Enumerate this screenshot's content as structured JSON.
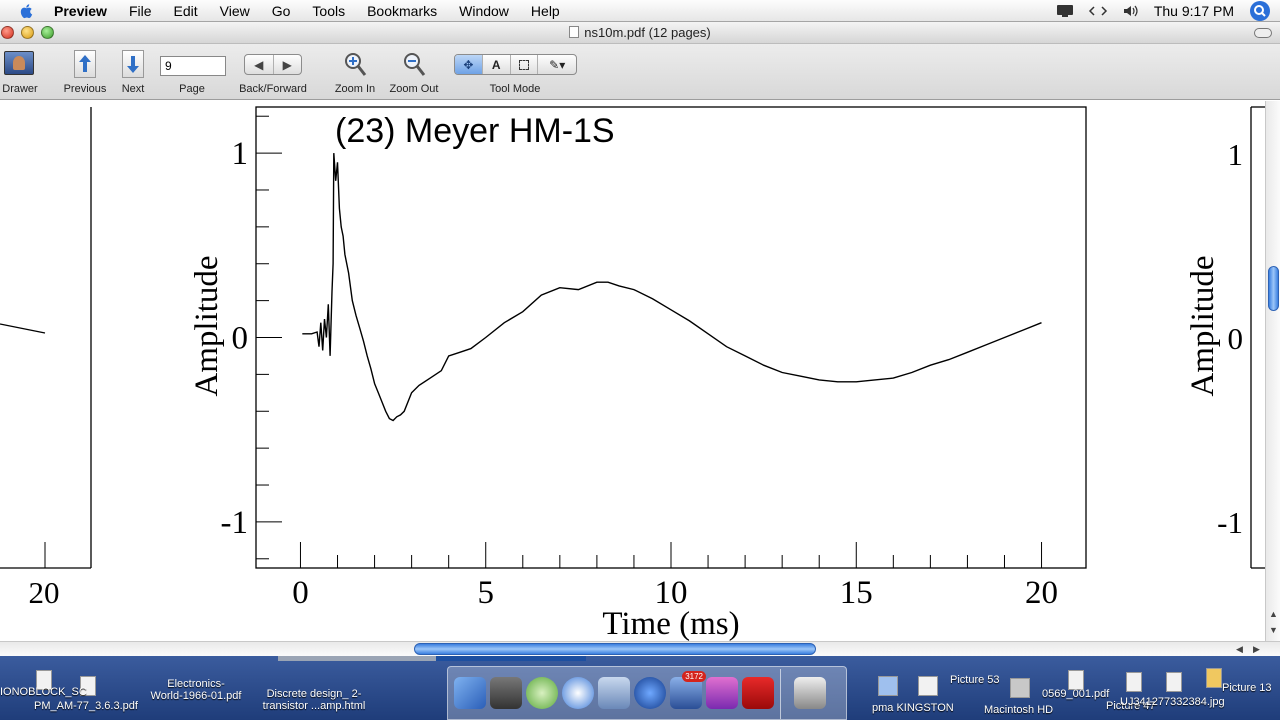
{
  "menubar": {
    "app_name": "Preview",
    "menus": [
      "File",
      "Edit",
      "View",
      "Go",
      "Tools",
      "Bookmarks",
      "Window",
      "Help"
    ],
    "clock": "Thu 9:17 PM",
    "status_icons": [
      "display-icon",
      "network-icon",
      "volume-icon",
      "spotlight-icon"
    ]
  },
  "window": {
    "title": "ns10m.pdf (12 pages)"
  },
  "toolbar": {
    "drawer_label": "Drawer",
    "previous_label": "Previous",
    "next_label": "Next",
    "page_value": "9",
    "page_label": "Page",
    "back_forward_label": "Back/Forward",
    "zoom_in_label": "Zoom In",
    "zoom_out_label": "Zoom Out",
    "tool_mode_label": "Tool Mode",
    "tool_modes": [
      "move-tool-icon",
      "text-tool-icon",
      "select-tool-icon",
      "annotate-tool-icon"
    ],
    "tool_text_glyph": "A"
  },
  "document": {
    "page_title": "(23) Meyer HM-1S"
  },
  "chart_data": {
    "type": "line",
    "title": "(23) Meyer HM-1S",
    "xlabel": "Time (ms)",
    "ylabel": "Amplitude",
    "xlim": [
      -1.2,
      21.2
    ],
    "ylim": [
      -1.25,
      1.25
    ],
    "x_ticks": [
      "0",
      "5",
      "10",
      "15",
      "20"
    ],
    "y_ticks": [
      "1",
      "0",
      "-1"
    ],
    "grid": false,
    "color": "#000000",
    "series": [
      {
        "x": [
          0.05,
          0.3,
          0.45,
          0.5,
          0.55,
          0.6,
          0.65,
          0.7,
          0.75,
          0.8,
          0.85,
          0.88,
          0.9,
          0.95,
          1.0,
          1.05,
          1.1,
          1.15,
          1.2,
          1.3,
          1.4,
          1.5,
          1.6,
          1.7,
          1.8,
          1.9,
          2.0,
          2.1,
          2.2,
          2.3,
          2.4,
          2.5,
          2.6,
          2.7,
          2.8,
          3.0,
          3.2,
          3.5,
          3.8,
          4.0,
          4.3,
          4.6,
          5.0,
          5.5,
          6.0,
          6.5,
          7.0,
          7.5,
          8.0,
          8.3,
          8.6,
          9.0,
          9.5,
          10.0,
          10.5,
          11.0,
          11.5,
          12.0,
          12.5,
          13.0,
          13.5,
          14.0,
          14.5,
          15.0,
          15.5,
          16.0,
          16.5,
          17.0,
          17.5,
          18.0,
          18.5,
          19.0,
          19.5,
          20.0
        ],
        "y": [
          0.02,
          0.02,
          0.03,
          -0.05,
          0.08,
          -0.07,
          0.1,
          0.0,
          0.18,
          -0.1,
          0.25,
          0.4,
          1.0,
          0.85,
          0.95,
          0.7,
          0.6,
          0.55,
          0.45,
          0.35,
          0.2,
          0.12,
          0.05,
          -0.02,
          -0.1,
          -0.17,
          -0.25,
          -0.3,
          -0.35,
          -0.4,
          -0.44,
          -0.45,
          -0.43,
          -0.42,
          -0.4,
          -0.3,
          -0.26,
          -0.22,
          -0.18,
          -0.1,
          -0.08,
          -0.06,
          0.0,
          0.08,
          0.14,
          0.23,
          0.27,
          0.26,
          0.3,
          0.3,
          0.28,
          0.26,
          0.21,
          0.15,
          0.09,
          0.02,
          -0.05,
          -0.1,
          -0.15,
          -0.19,
          -0.21,
          -0.23,
          -0.24,
          -0.24,
          -0.23,
          -0.22,
          -0.19,
          -0.15,
          -0.12,
          -0.08,
          -0.04,
          0.0,
          0.04,
          0.08
        ]
      }
    ]
  },
  "neighbor_pages": {
    "left_tick": "20",
    "right_ylabel": "Amplitude",
    "right_ticks": [
      "1",
      "0",
      "-1"
    ]
  },
  "desktop": {
    "files": [
      {
        "label": "IONOBLOCK_SC"
      },
      {
        "label": "PM_AM-77_3.6.3.pdf"
      },
      {
        "label": "Electronics-"
      },
      {
        "label": "World-1966-01.pdf"
      },
      {
        "label": "Discrete design_ 2-"
      },
      {
        "label": "transistor ...amp.html"
      },
      {
        "label": "pma KINGSTON"
      },
      {
        "label": "Picture 53"
      },
      {
        "label": "Macintosh HD"
      },
      {
        "label": "0569_001.pdf"
      },
      {
        "label": "Picture 47"
      },
      {
        "label": "UJ341277332384.jpg"
      },
      {
        "label": "Picture 13"
      }
    ],
    "dock_badge": "3172"
  }
}
